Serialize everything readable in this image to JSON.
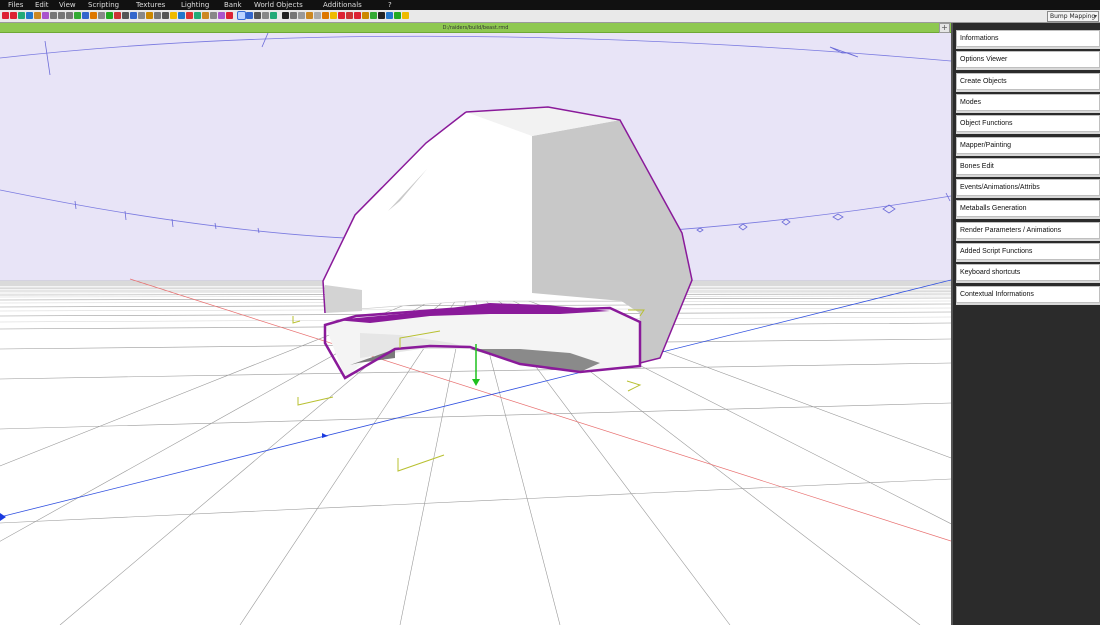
{
  "menubar": {
    "items": [
      {
        "label": "Files"
      },
      {
        "label": "Edit"
      },
      {
        "label": "View"
      },
      {
        "label": "Scripting"
      },
      {
        "label": "Textures"
      },
      {
        "label": "Lighting"
      },
      {
        "label": "Bank"
      },
      {
        "label": "World Objects"
      },
      {
        "label": "Additionals"
      },
      {
        "label": "?"
      }
    ]
  },
  "toolbar": {
    "render_mode": "Bump Mapping",
    "icons": [
      "undo-icon",
      "redo-icon",
      "select-icon",
      "move-icon",
      "rotate-icon",
      "scale-icon",
      "vertex-icon",
      "edge-icon",
      "face-icon",
      "object-icon",
      "group-icon",
      "split-icon",
      "weld-icon",
      "extrude-icon",
      "bevel-icon",
      "cut-icon",
      "mirror-icon",
      "align-icon",
      "snap-icon",
      "grid-icon",
      "camera-icon",
      "light-icon",
      "cube-icon",
      "sphere-icon",
      "cylinder-icon",
      "cone-icon",
      "plane-icon",
      "torus-icon",
      "magnet-icon",
      "select-box-icon",
      "lasso-icon",
      "zoom-icon",
      "pan-icon",
      "orbit-icon",
      "eye-icon",
      "wire-icon",
      "shade-icon",
      "texture-icon",
      "bone-icon",
      "paint-icon",
      "bulb-icon",
      "play-icon",
      "stop-icon",
      "record-icon",
      "key-icon",
      "curve-icon",
      "render-icon",
      "image-icon",
      "export-icon",
      "help-icon"
    ],
    "icon_colors": [
      "#d23",
      "#d23",
      "#2a7",
      "#27c",
      "#c82",
      "#a5c",
      "#777",
      "#777",
      "#777",
      "#3a3",
      "#36c",
      "#d70",
      "#888",
      "#2a2",
      "#c33",
      "#555",
      "#36c",
      "#888",
      "#c80",
      "#777",
      "#555",
      "#eb0",
      "#27c",
      "#d33",
      "#2a7",
      "#c82",
      "#888",
      "#a5c",
      "#d23",
      "#27c",
      "#36c",
      "#555",
      "#888",
      "#2a7",
      "#222",
      "#777",
      "#999",
      "#c82",
      "#aaa",
      "#d70",
      "#eb0",
      "#d23",
      "#c33",
      "#d23",
      "#c80",
      "#3a3",
      "#222",
      "#27c",
      "#2a2",
      "#eb0"
    ],
    "active_index": 29
  },
  "path_bar": {
    "path": "D:/raiders/build/beast.rmd",
    "add_label": "+"
  },
  "panel": {
    "buttons": [
      {
        "label": "Informations"
      },
      {
        "label": "Options Viewer"
      },
      {
        "label": "Create Objects"
      },
      {
        "label": "Modes"
      },
      {
        "label": "Object Functions"
      },
      {
        "label": "Mapper/Painting"
      },
      {
        "label": "Bones Edit"
      },
      {
        "label": "Events/Animations/Attribs"
      },
      {
        "label": "Metaballs Generation"
      },
      {
        "label": "Render Parameters / Animations"
      },
      {
        "label": "Added Script Functions"
      },
      {
        "label": "Keyboard shortcuts"
      },
      {
        "label": "Contextual Informations"
      }
    ]
  },
  "colors": {
    "sky": "#e8e4f7",
    "selection": "#8a1a9a",
    "gizmo_y": "#1ec01e",
    "bbox": "#b8c030",
    "axis_x": "#e04040",
    "axis_z": "#2040e0",
    "path_bar": "#8ec850"
  }
}
